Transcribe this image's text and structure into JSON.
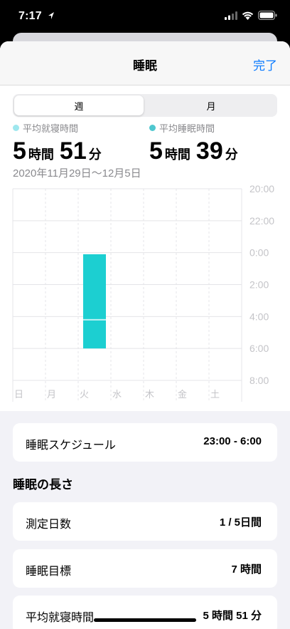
{
  "status": {
    "time": "7:17"
  },
  "nav": {
    "title": "睡眠",
    "done": "完了"
  },
  "segments": {
    "week": "週",
    "month": "月"
  },
  "stats": {
    "bedtime": {
      "label": "平均就寝時間",
      "hours": "5",
      "hours_unit": "時間",
      "minutes": "51",
      "minutes_unit": "分",
      "color": "#9ee7ee"
    },
    "sleep": {
      "label": "平均睡眠時間",
      "hours": "5",
      "hours_unit": "時間",
      "minutes": "39",
      "minutes_unit": "分",
      "color": "#4fc7cf"
    }
  },
  "date_range": "2020年11月29日〜12月5日",
  "chart_data": {
    "type": "bar",
    "categories": [
      "日",
      "月",
      "火",
      "水",
      "木",
      "金",
      "土"
    ],
    "y_ticks": [
      "20:00",
      "22:00",
      "0:00",
      "2:00",
      "4:00",
      "6:00",
      "8:00"
    ],
    "y_range_hours": [
      20,
      32
    ],
    "series": [
      {
        "values": [
          null,
          null,
          [
            0.1,
            6.0
          ],
          null,
          null,
          null,
          null
        ],
        "color": "#1ccfd1"
      }
    ],
    "divider_at": 4.2
  },
  "schedule": {
    "label": "睡眠スケジュール",
    "value": "23:00 - 6:00"
  },
  "section_title": "睡眠の長さ",
  "rows": [
    {
      "label": "測定日数",
      "value": "1 / 5日間"
    },
    {
      "label": "睡眠目標",
      "value": "7 時間"
    },
    {
      "label": "平均就寝時間",
      "value": "5 時間 51 分"
    }
  ]
}
